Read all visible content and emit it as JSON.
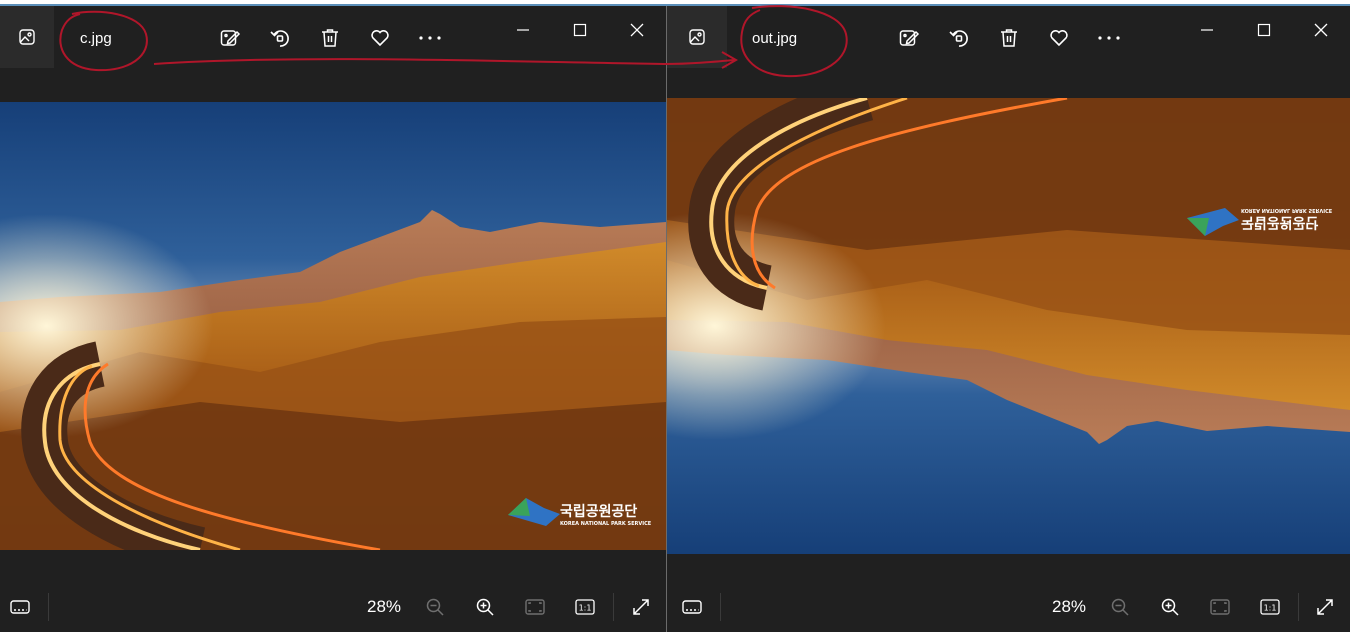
{
  "left_window": {
    "filename": "c.jpg",
    "zoom": "28%",
    "logo": {
      "korean": "국립공원공단",
      "english": "KOREA NATIONAL PARK SERVICE"
    }
  },
  "right_window": {
    "filename": "out.jpg",
    "zoom": "28%",
    "logo": {
      "korean": "국립공원공단",
      "english": "KOREA NATIONAL PARK SERVICE"
    }
  },
  "colors": {
    "window_bg": "#202020",
    "accent": "#5b8fb9",
    "annotation": "#b0162a"
  },
  "icons": {
    "titlebar": [
      "gallery-icon",
      "edit-icon",
      "rotate-icon",
      "delete-icon",
      "favorite-icon",
      "more-icon",
      "minimize-icon",
      "maximize-icon",
      "close-icon"
    ],
    "bottombar": [
      "filmstrip-icon",
      "zoom-out-icon",
      "zoom-in-icon",
      "fit-to-window-icon",
      "actual-size-icon",
      "fullscreen-icon"
    ]
  }
}
